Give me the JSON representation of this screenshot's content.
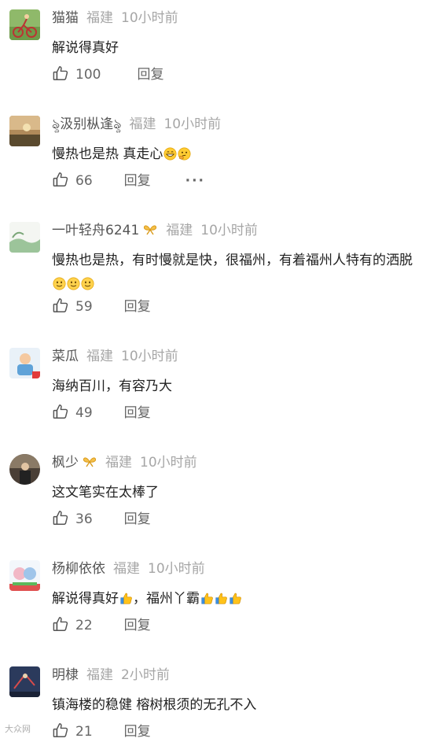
{
  "reply_label": "回复",
  "more_label": "···",
  "comments": [
    {
      "name": "猫猫",
      "location": "福建",
      "time": "10小时前",
      "text": "解说得真好",
      "likes": "100",
      "badge": false
    },
    {
      "name": "ৡ汲别枞逢ৡ",
      "location": "福建",
      "time": "10小时前",
      "text": "慢热也是热 真走心",
      "likes": "66",
      "badge": false
    },
    {
      "name": "一叶轻舟6241",
      "location": "福建",
      "time": "10小时前",
      "text": "慢热也是热，有时慢就是快，很福州，有着福州人特有的洒脱",
      "likes": "59",
      "badge": true
    },
    {
      "name": "菜瓜",
      "location": "福建",
      "time": "10小时前",
      "text": "海纳百川，有容乃大",
      "likes": "49",
      "badge": false
    },
    {
      "name": "枫少",
      "location": "福建",
      "time": "10小时前",
      "text": "这文笔实在太棒了",
      "likes": "36",
      "badge": true
    },
    {
      "name": "杨柳依依",
      "location": "福建",
      "time": "10小时前",
      "text_a": "解说得真好",
      "text_b": "，福州丫霸",
      "likes": "22",
      "badge": false
    },
    {
      "name": "明棣",
      "location": "福建",
      "time": "2小时前",
      "text": "镇海楼的稳健 榕树根须的无孔不入",
      "likes": "21",
      "badge": false
    }
  ],
  "watermark": "大众网"
}
